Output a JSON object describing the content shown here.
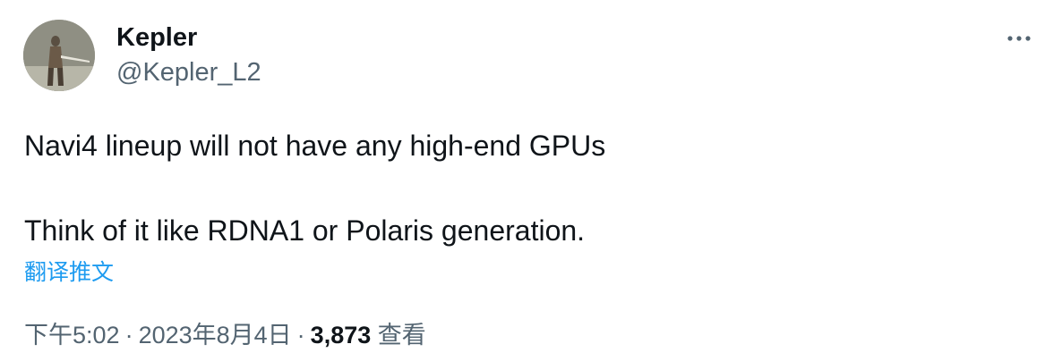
{
  "author": {
    "display_name": "Kepler",
    "handle": "@Kepler_L2",
    "avatar_icon": "user-avatar"
  },
  "more_icon": "more-horizontal-icon",
  "tweet": {
    "line1": "Navi4 lineup will not have any high-end GPUs",
    "line2": "Think of it like RDNA1 or Polaris generation."
  },
  "translate_label": "翻译推文",
  "meta": {
    "time": "下午5:02",
    "separator": "·",
    "date": "2023年8月4日",
    "views_count": "3,873",
    "views_label": "查看"
  },
  "colors": {
    "text": "#0f1419",
    "secondary": "#536471",
    "link": "#1d9bf0"
  }
}
